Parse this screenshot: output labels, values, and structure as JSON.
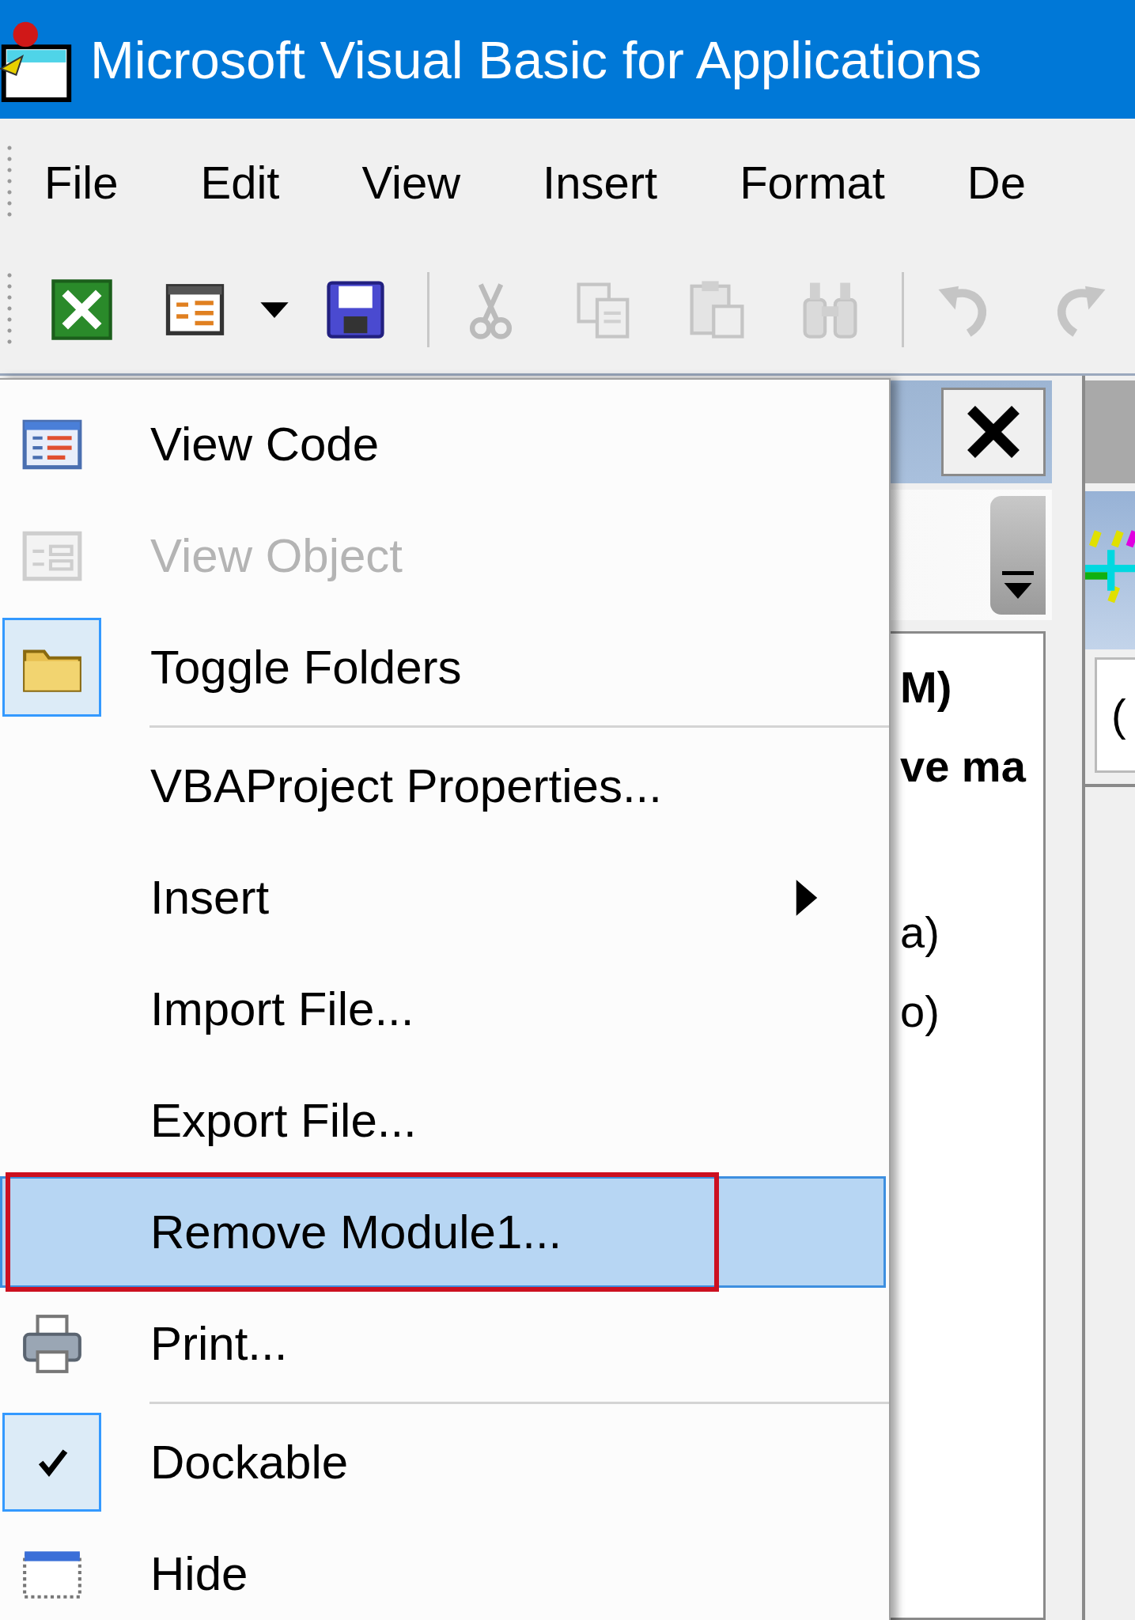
{
  "window": {
    "title": "Microsoft Visual Basic for Applications"
  },
  "menu_bar": [
    {
      "label": "File"
    },
    {
      "label": "Edit"
    },
    {
      "label": "View"
    },
    {
      "label": "Insert"
    },
    {
      "label": "Format"
    },
    {
      "label": "De"
    }
  ],
  "toolbar": [
    {
      "kind": "excel",
      "disabled": false
    },
    {
      "kind": "userform",
      "disabled": false
    },
    {
      "kind": "caret",
      "disabled": false
    },
    {
      "kind": "save",
      "disabled": false
    },
    {
      "kind": "separator"
    },
    {
      "kind": "cut",
      "disabled": true
    },
    {
      "kind": "copy",
      "disabled": true
    },
    {
      "kind": "paste",
      "disabled": true
    },
    {
      "kind": "find",
      "disabled": true
    },
    {
      "kind": "separator"
    },
    {
      "kind": "undo",
      "disabled": true
    },
    {
      "kind": "redo",
      "disabled": true
    }
  ],
  "project_pane": {
    "tree_items": [
      {
        "text": "M)",
        "bold": true
      },
      {
        "text": "ve ma",
        "bold": true
      },
      {
        "text": "a)",
        "bold": false
      },
      {
        "text": "o)",
        "bold": false
      }
    ]
  },
  "properties_pane": {
    "field_text": "("
  },
  "context_menu": {
    "groups": [
      [
        {
          "label": "View Code",
          "kind": "code-window",
          "disabled": false,
          "checked": false,
          "submenu": false,
          "selected": false,
          "annotated": false
        },
        {
          "label": "View Object",
          "kind": "object-window",
          "disabled": true,
          "checked": false,
          "submenu": false,
          "selected": false,
          "annotated": false
        },
        {
          "label": "Toggle Folders",
          "kind": "folder",
          "disabled": false,
          "checked": true,
          "submenu": false,
          "selected": false,
          "annotated": false
        }
      ],
      [
        {
          "label": "VBAProject Properties...",
          "kind": "plain",
          "disabled": false,
          "checked": false,
          "submenu": false,
          "selected": false,
          "annotated": false
        },
        {
          "label": "Insert",
          "kind": "plain",
          "disabled": false,
          "checked": false,
          "submenu": true,
          "selected": false,
          "annotated": false
        },
        {
          "label": "Import File...",
          "kind": "plain",
          "disabled": false,
          "checked": false,
          "submenu": false,
          "selected": false,
          "annotated": false
        },
        {
          "label": "Export File...",
          "kind": "plain",
          "disabled": false,
          "checked": false,
          "submenu": false,
          "selected": false,
          "annotated": false
        },
        {
          "label": "Remove Module1...",
          "kind": "plain",
          "disabled": false,
          "checked": false,
          "submenu": false,
          "selected": true,
          "annotated": true
        },
        {
          "label": "Print...",
          "kind": "printer",
          "disabled": false,
          "checked": false,
          "submenu": false,
          "selected": false,
          "annotated": false
        }
      ],
      [
        {
          "label": "Dockable",
          "kind": "plain",
          "disabled": false,
          "checked": true,
          "submenu": false,
          "selected": false,
          "annotated": false
        },
        {
          "label": "Hide",
          "kind": "hide-window",
          "disabled": false,
          "checked": false,
          "submenu": false,
          "selected": false,
          "annotated": false
        }
      ]
    ]
  }
}
